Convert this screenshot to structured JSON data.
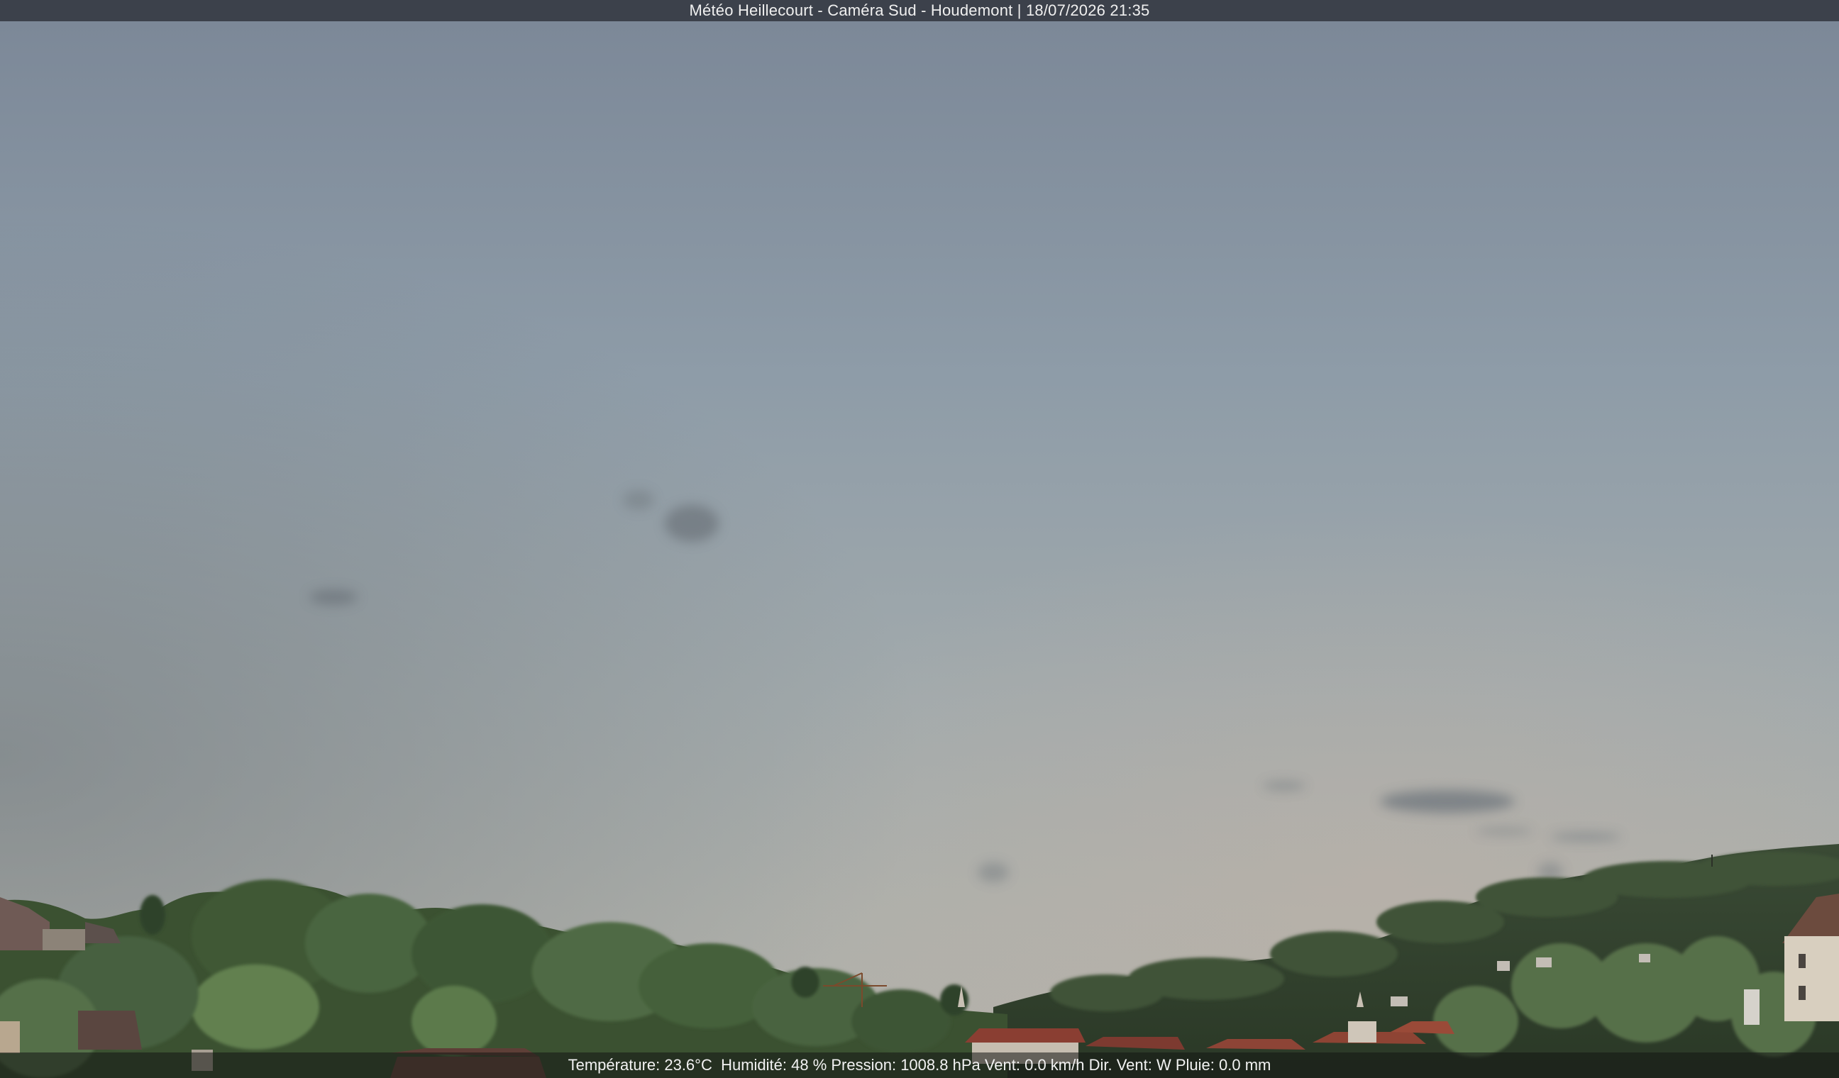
{
  "overlay": {
    "title": "Météo Heillecourt - Caméra Sud - Houdemont | 18/07/2026 21:35",
    "weather_line": "Température: 23.6°C  Humidité: 48 % Pression: 1008.8 hPa Vent: 0.0 km/h Dir. Vent: W Pluie: 0.0 mm"
  },
  "colors": {
    "title_bar": "#3c414b",
    "sky_top": "#7c8898",
    "sky_mid": "#9ba7ae",
    "sky_horizon": "#aeb0ac",
    "foliage_dark": "#2e3f2a",
    "foliage_light": "#5d7a4c",
    "roof": "#8a3e32"
  },
  "scene": {
    "type": "webcam-photo",
    "content": "evening sky with wooded hills, trees, a construction crane and red-roofed houses along the bottom"
  }
}
